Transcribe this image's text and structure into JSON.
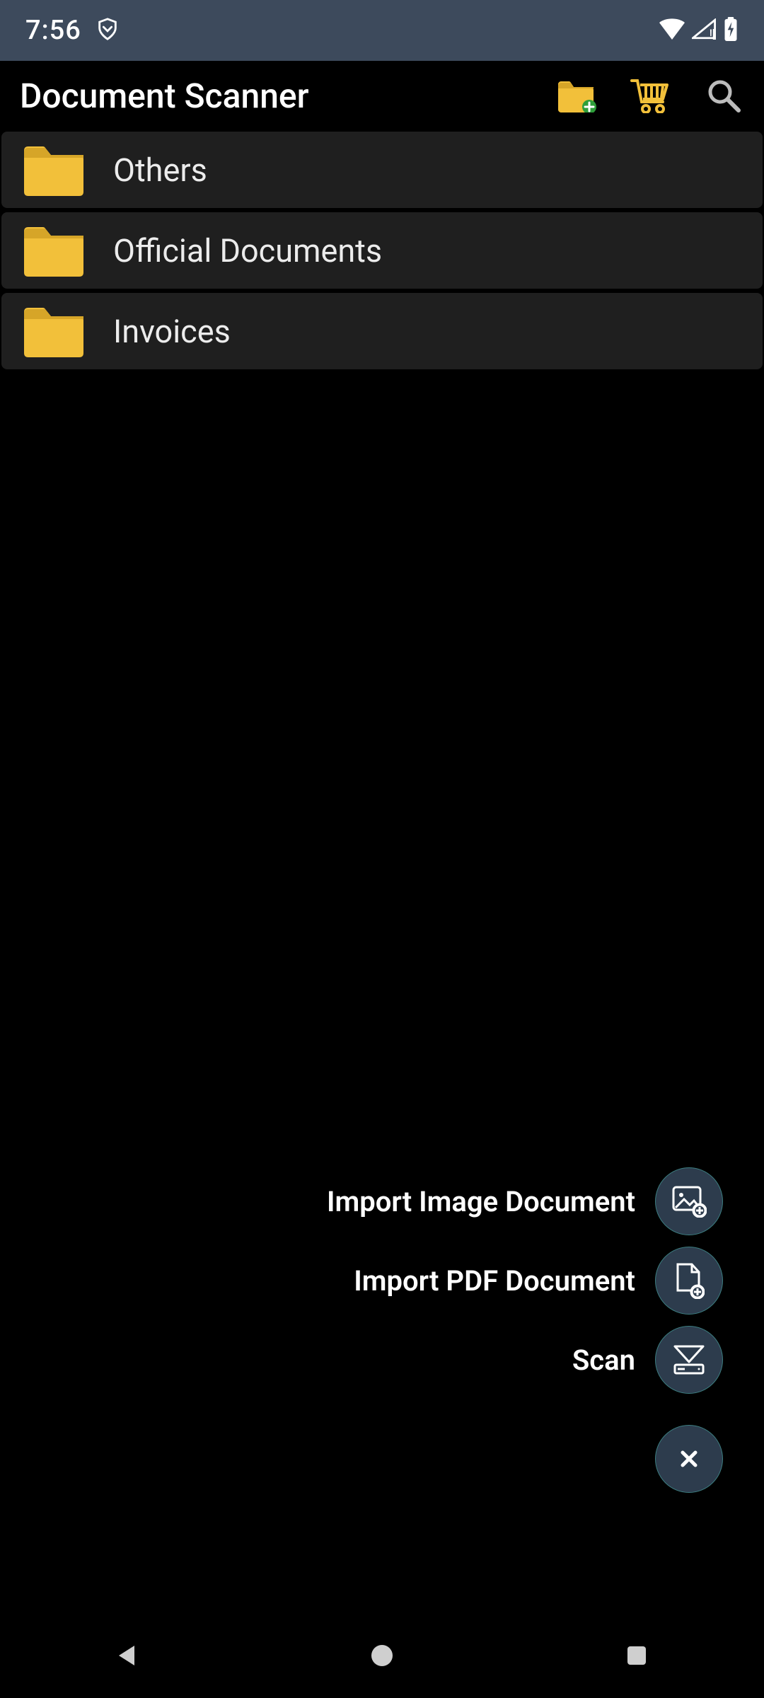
{
  "status": {
    "time": "7:56"
  },
  "appbar": {
    "title": "Document Scanner"
  },
  "folders": [
    {
      "label": "Others"
    },
    {
      "label": "Official Documents"
    },
    {
      "label": "Invoices"
    }
  ],
  "fab": {
    "import_image": "Import Image Document",
    "import_pdf": "Import PDF Document",
    "scan": "Scan"
  },
  "colors": {
    "statusbar_bg": "#3d4a5c",
    "folder_yellow": "#f2c03a",
    "cart_yellow": "#f2c03a",
    "fab_bg": "#2d3c4d"
  }
}
